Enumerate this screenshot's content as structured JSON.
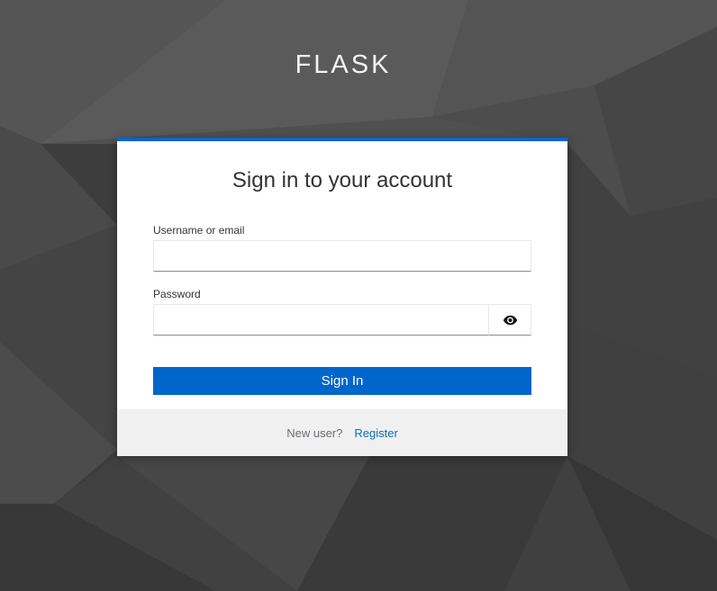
{
  "header": {
    "brand": "FLASK"
  },
  "login": {
    "title": "Sign in to your account",
    "username_label": "Username or email",
    "username_value": "",
    "password_label": "Password",
    "password_value": "",
    "toggle_icon": "eye-icon",
    "submit_label": "Sign In",
    "register_prompt": "New user?",
    "register_link": "Register"
  },
  "colors": {
    "accent": "#0066cc",
    "link": "#0b6fb5",
    "background": "#3a3a3a",
    "footer_bg": "#f0f0f0"
  }
}
